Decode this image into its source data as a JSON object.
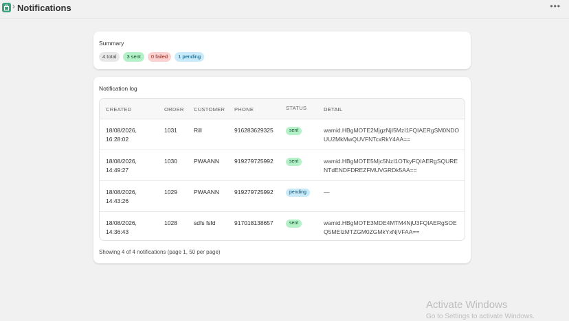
{
  "header": {
    "app_icon": "bag-icon",
    "chevron": "›",
    "title": "Notifications",
    "more_icon": "•••"
  },
  "summary": {
    "title": "Summary",
    "badges": {
      "total": "4 total",
      "sent": "3 sent",
      "failed": "0 failed",
      "pending": "1 pending"
    }
  },
  "log": {
    "title": "Notification log",
    "columns": {
      "created": "CREATED",
      "order": "ORDER",
      "customer": "CUSTOMER",
      "phone": "PHONE",
      "status": "STATUS",
      "detail": "DETAIL"
    },
    "rows": [
      {
        "created": "18/08/2026, 16:28:02",
        "order": "1031",
        "customer": "Rill",
        "phone": "916283629325",
        "status": "sent",
        "detail": "wamid.HBgMOTE2MjgzNjI5MzI1FQIAERgSM0NDOUU2MkMwQUVFNTcxRkY4AA=="
      },
      {
        "created": "18/08/2026, 14:49:27",
        "order": "1030",
        "customer": "PWAANN",
        "phone": "919279725992",
        "status": "sent",
        "detail": "wamid.HBgMOTE5Mjc5NzI1OTkyFQIAERgSQURENTdENDFDREZFMUVGRDk5AA=="
      },
      {
        "created": "18/08/2026, 14:43:26",
        "order": "1029",
        "customer": "PWAANN",
        "phone": "919279725992",
        "status": "pending",
        "detail": "—"
      },
      {
        "created": "18/08/2026, 14:36:43",
        "order": "1028",
        "customer": "sdfs fsfd",
        "phone": "917018138657",
        "status": "sent",
        "detail": "wamid.HBgMOTE3MDE4MTM4NjU3FQIAERgSOEQ5MEIzMTZGM0ZGMkYxNjVFAA=="
      }
    ],
    "footer": "Showing 4 of 4 notifications (page 1, 50 per page)"
  },
  "watermark": {
    "title": "Activate Windows",
    "subtitle": "Go to Settings to activate Windows."
  }
}
